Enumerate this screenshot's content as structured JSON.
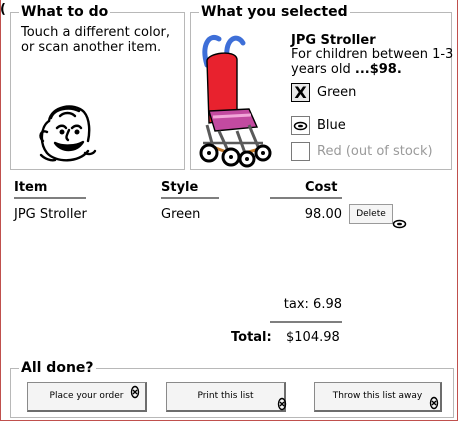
{
  "what_to_do": {
    "title": "What to do",
    "instructions": "Touch a different color, or scan another item.",
    "icon": "smiling-face-icon"
  },
  "selection": {
    "title": "What you selected",
    "product_name": "JPG Stroller",
    "product_desc": "For children between 1-3 years old",
    "price": "...$98.",
    "icon": "stroller-icon",
    "colors": [
      {
        "label": "Green",
        "mark": "X",
        "state": "selected"
      },
      {
        "label": "Blue",
        "mark": "",
        "state": "available"
      },
      {
        "label": "Red (out of stock)",
        "mark": "",
        "state": "out_of_stock"
      }
    ]
  },
  "list": {
    "headers": [
      "Item",
      "Style",
      "Cost"
    ],
    "rows": [
      {
        "item": "JPG Stroller",
        "style": "Green",
        "cost": "98.00",
        "action": "Delete"
      }
    ],
    "tax_label": "tax:",
    "tax_value": "6.98",
    "total_label": "Total:",
    "total_value": "$104.98"
  },
  "all_done": {
    "title": "All done?",
    "buttons": [
      "Place your order",
      "Print this list",
      "Throw this list away"
    ]
  },
  "frame_stub": "("
}
